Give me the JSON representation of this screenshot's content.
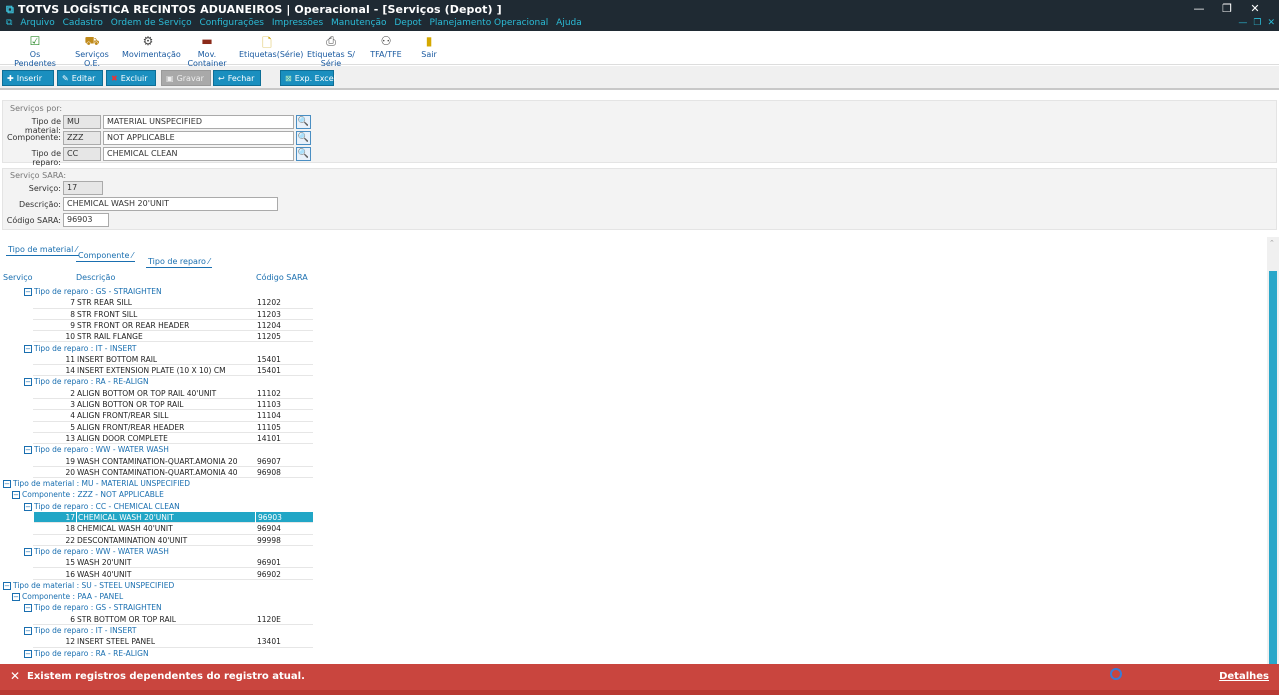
{
  "window": {
    "title": "TOTVS LOGÍSTICA RECINTOS ADUANEIROS | Operacional - [Serviços (Depot) ]",
    "controls": [
      "—",
      "❐",
      "✕"
    ]
  },
  "menu": [
    "Arquivo",
    "Cadastro",
    "Ordem de Serviço",
    "Configurações",
    "Impressões",
    "Manutenção",
    "Depot",
    "Planejamento Operacional",
    "Ajuda"
  ],
  "toolbar": [
    {
      "label": "Os Pendentes",
      "icon": "checklist-icon"
    },
    {
      "label": "Serviços O.E.",
      "icon": "truck-icon"
    },
    {
      "label": "Movimentação",
      "icon": "crane-icon"
    },
    {
      "label": "Mov. Container",
      "icon": "container-icon"
    },
    {
      "label": "Etiquetas(Série)",
      "icon": "label-icon"
    },
    {
      "label": "Etiquetas S/ Série",
      "icon": "printer-icon"
    },
    {
      "label": "TFA/TFE",
      "icon": "people-icon"
    },
    {
      "label": "Sair",
      "icon": "exit-door-icon"
    }
  ],
  "actions": {
    "insert": "Inserir",
    "edit": "Editar",
    "delete": "Excluir",
    "save": "Gravar",
    "close": "Fechar",
    "export": "Exp. Excel"
  },
  "servicos_por": {
    "section": "Serviços por:",
    "tipo_material": {
      "label": "Tipo de material:",
      "code": "MU",
      "desc": "MATERIAL UNSPECIFIED"
    },
    "componente": {
      "label": "Componente:",
      "code": "ZZZ",
      "desc": "NOT APPLICABLE"
    },
    "tipo_reparo": {
      "label": "Tipo de reparo:",
      "code": "CC",
      "desc": "CHEMICAL CLEAN"
    }
  },
  "servico_sara": {
    "section": "Serviço SARA:",
    "servico": {
      "label": "Serviço:",
      "value": "17"
    },
    "descricao": {
      "label": "Descrição:",
      "value": "CHEMICAL WASH 20'UNIT"
    },
    "codigo": {
      "label": "Código SARA:",
      "value": "96903"
    }
  },
  "grouping": [
    "Tipo de material",
    "Componente",
    "Tipo de reparo"
  ],
  "grid": {
    "headers": [
      "Serviço",
      "Descrição",
      "Código SARA"
    ],
    "rows": [
      {
        "type": "g2",
        "text": "Tipo de reparo : GS - STRAIGHTEN"
      },
      {
        "type": "d",
        "id": "7",
        "desc": "STR REAR SILL",
        "code": "11202"
      },
      {
        "type": "d",
        "id": "8",
        "desc": "STR FRONT SILL",
        "code": "11203"
      },
      {
        "type": "d",
        "id": "9",
        "desc": "STR FRONT OR REAR HEADER",
        "code": "11204"
      },
      {
        "type": "d",
        "id": "10",
        "desc": "STR RAIL FLANGE",
        "code": "11205"
      },
      {
        "type": "g2",
        "text": "Tipo de reparo : IT - INSERT"
      },
      {
        "type": "d",
        "id": "11",
        "desc": "INSERT BOTTOM RAIL",
        "code": "15401"
      },
      {
        "type": "d",
        "id": "14",
        "desc": "INSERT EXTENSION PLATE  (10 X 10) CM",
        "code": "15401"
      },
      {
        "type": "g2",
        "text": "Tipo de reparo : RA - RE-ALIGN"
      },
      {
        "type": "d",
        "id": "2",
        "desc": "ALIGN BOTTOM OR TOP RAIL 40'UNIT",
        "code": "11102"
      },
      {
        "type": "d",
        "id": "3",
        "desc": "ALIGN BOTTON OR TOP RAIL",
        "code": "11103"
      },
      {
        "type": "d",
        "id": "4",
        "desc": "ALIGN FRONT/REAR SILL",
        "code": "11104"
      },
      {
        "type": "d",
        "id": "5",
        "desc": "ALIGN FRONT/REAR HEADER",
        "code": "11105"
      },
      {
        "type": "d",
        "id": "13",
        "desc": "ALIGN DOOR COMPLETE",
        "code": "14101"
      },
      {
        "type": "g2",
        "text": "Tipo de reparo : WW - WATER WASH"
      },
      {
        "type": "d",
        "id": "19",
        "desc": "WASH CONTAMINATION-QUART.AMONIA 20",
        "code": "96907"
      },
      {
        "type": "d",
        "id": "20",
        "desc": "WASH CONTAMINATION-QUART.AMONIA 40",
        "code": "96908"
      },
      {
        "type": "g0",
        "text": "Tipo de material : MU - MATERIAL UNSPECIFIED"
      },
      {
        "type": "g1",
        "text": "Componente : ZZZ - NOT APPLICABLE"
      },
      {
        "type": "g2",
        "text": "Tipo de reparo : CC - CHEMICAL CLEAN"
      },
      {
        "type": "d",
        "id": "17",
        "desc": "CHEMICAL WASH 20'UNIT",
        "code": "96903",
        "sel": true
      },
      {
        "type": "d",
        "id": "18",
        "desc": "CHEMICAL WASH 40'UNIT",
        "code": "96904"
      },
      {
        "type": "d",
        "id": "22",
        "desc": "DESCONTAMINATION 40'UNIT",
        "code": "99998"
      },
      {
        "type": "g2",
        "text": "Tipo de reparo : WW - WATER WASH"
      },
      {
        "type": "d",
        "id": "15",
        "desc": "WASH 20'UNIT",
        "code": "96901"
      },
      {
        "type": "d",
        "id": "16",
        "desc": "WASH 40'UNIT",
        "code": "96902"
      },
      {
        "type": "g0",
        "text": "Tipo de material : SU - STEEL UNSPECIFIED"
      },
      {
        "type": "g1",
        "text": "Componente : PAA - PANEL"
      },
      {
        "type": "g2",
        "text": "Tipo de reparo : GS - STRAIGHTEN"
      },
      {
        "type": "d",
        "id": "6",
        "desc": "STR BOTTOM OR TOP RAIL",
        "code": "1120E"
      },
      {
        "type": "g2",
        "text": "Tipo de reparo : IT - INSERT"
      },
      {
        "type": "d",
        "id": "12",
        "desc": "INSERT STEEL PANEL",
        "code": "13401"
      },
      {
        "type": "g2",
        "text": "Tipo de reparo : RA - RE-ALIGN"
      }
    ]
  },
  "toast": {
    "message": "Existem registros dependentes do registro atual.",
    "details": "Detalhes",
    "close": "✕"
  },
  "colors": {
    "accent": "#21a6c6",
    "titlebar": "#1f2a33",
    "error": "#c9453e"
  }
}
